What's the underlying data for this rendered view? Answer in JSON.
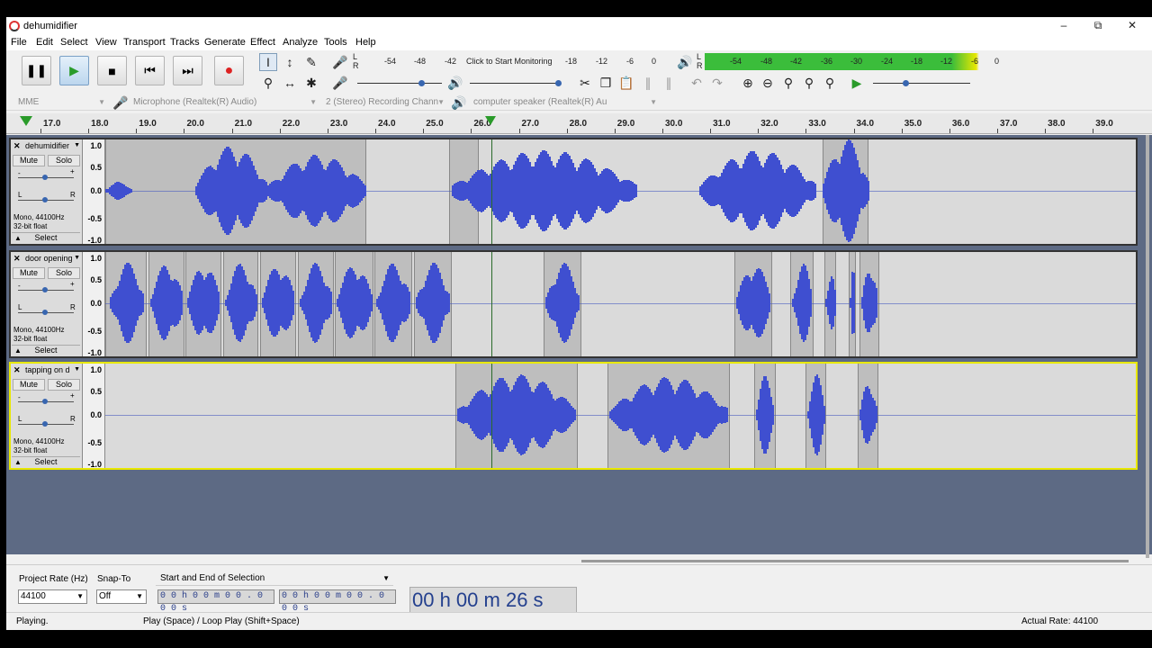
{
  "window": {
    "title": "dehumidifier"
  },
  "menu": [
    "File",
    "Edit",
    "Select",
    "View",
    "Transport",
    "Tracks",
    "Generate",
    "Effect",
    "Analyze",
    "Tools",
    "Help"
  ],
  "meter": {
    "record_scale": [
      "-54",
      "-48",
      "-42",
      "Click to Start Monitoring",
      "-18",
      "-12",
      "-6",
      "0"
    ],
    "play_scale": [
      "-54",
      "-48",
      "-42",
      "-36",
      "-30",
      "-24",
      "-18",
      "-12",
      "-6",
      "0"
    ],
    "lr": [
      "L",
      "R"
    ]
  },
  "devices": {
    "host": "MME",
    "recording_device": "Microphone (Realtek(R) Audio)",
    "channels": "2 (Stereo) Recording Chann",
    "playback_device": "computer speaker (Realtek(R) Au"
  },
  "timeline": {
    "ticks": [
      "17.0",
      "18.0",
      "19.0",
      "20.0",
      "21.0",
      "22.0",
      "23.0",
      "24.0",
      "25.0",
      "26.0",
      "27.0",
      "28.0",
      "29.0",
      "30.0",
      "31.0",
      "32.0",
      "33.0",
      "34.0",
      "35.0",
      "36.0",
      "37.0",
      "38.0",
      "39.0"
    ]
  },
  "tracks": [
    {
      "name": "dehumidifier",
      "mute": "Mute",
      "solo": "Solo",
      "format_line1": "Mono, 44100Hz",
      "format_line2": "32-bit float",
      "select": "Select",
      "lr": [
        "L",
        "R"
      ],
      "pm": [
        "-",
        "+"
      ]
    },
    {
      "name": "door opening",
      "mute": "Mute",
      "solo": "Solo",
      "format_line1": "Mono, 44100Hz",
      "format_line2": "32-bit float",
      "select": "Select",
      "lr": [
        "L",
        "R"
      ],
      "pm": [
        "-",
        "+"
      ]
    },
    {
      "name": "tapping on d",
      "mute": "Mute",
      "solo": "Solo",
      "format_line1": "Mono, 44100Hz",
      "format_line2": "32-bit float",
      "select": "Select",
      "lr": [
        "L",
        "R"
      ],
      "pm": [
        "-",
        "+"
      ]
    }
  ],
  "vruler": [
    "1.0",
    "0.5",
    "0.0",
    "-0.5",
    "-1.0"
  ],
  "selection": {
    "project_rate_label": "Project Rate (Hz)",
    "project_rate_value": "44100",
    "snap_to_label": "Snap-To",
    "snap_to_value": "Off",
    "selection_mode": "Start and End of Selection",
    "start_time": "0 0 h 0 0 m 0 0 . 0 0 0 s",
    "end_time": "0 0 h 0 0 m 0 0 . 0 0 0 s",
    "audio_position": "00 h 00 m 26 s"
  },
  "status": {
    "state": "Playing.",
    "hint": "Play (Space) / Loop Play (Shift+Space)",
    "rate": "Actual Rate: 44100"
  },
  "icons": [
    "pause-icon",
    "play-icon",
    "stop-icon",
    "skip-start-icon",
    "skip-end-icon",
    "record-icon",
    "selection-tool-icon",
    "envelope-tool-icon",
    "draw-tool-icon",
    "zoom-tool-icon",
    "timeshift-tool-icon",
    "multi-tool-icon",
    "microphone-icon",
    "speaker-icon",
    "cut-icon",
    "copy-icon",
    "paste-icon",
    "trim-icon",
    "silence-icon",
    "undo-icon",
    "redo-icon",
    "zoom-in-icon",
    "zoom-out-icon",
    "fit-selection-icon",
    "fit-project-icon",
    "zoom-toggle-icon",
    "play-at-speed-icon"
  ]
}
